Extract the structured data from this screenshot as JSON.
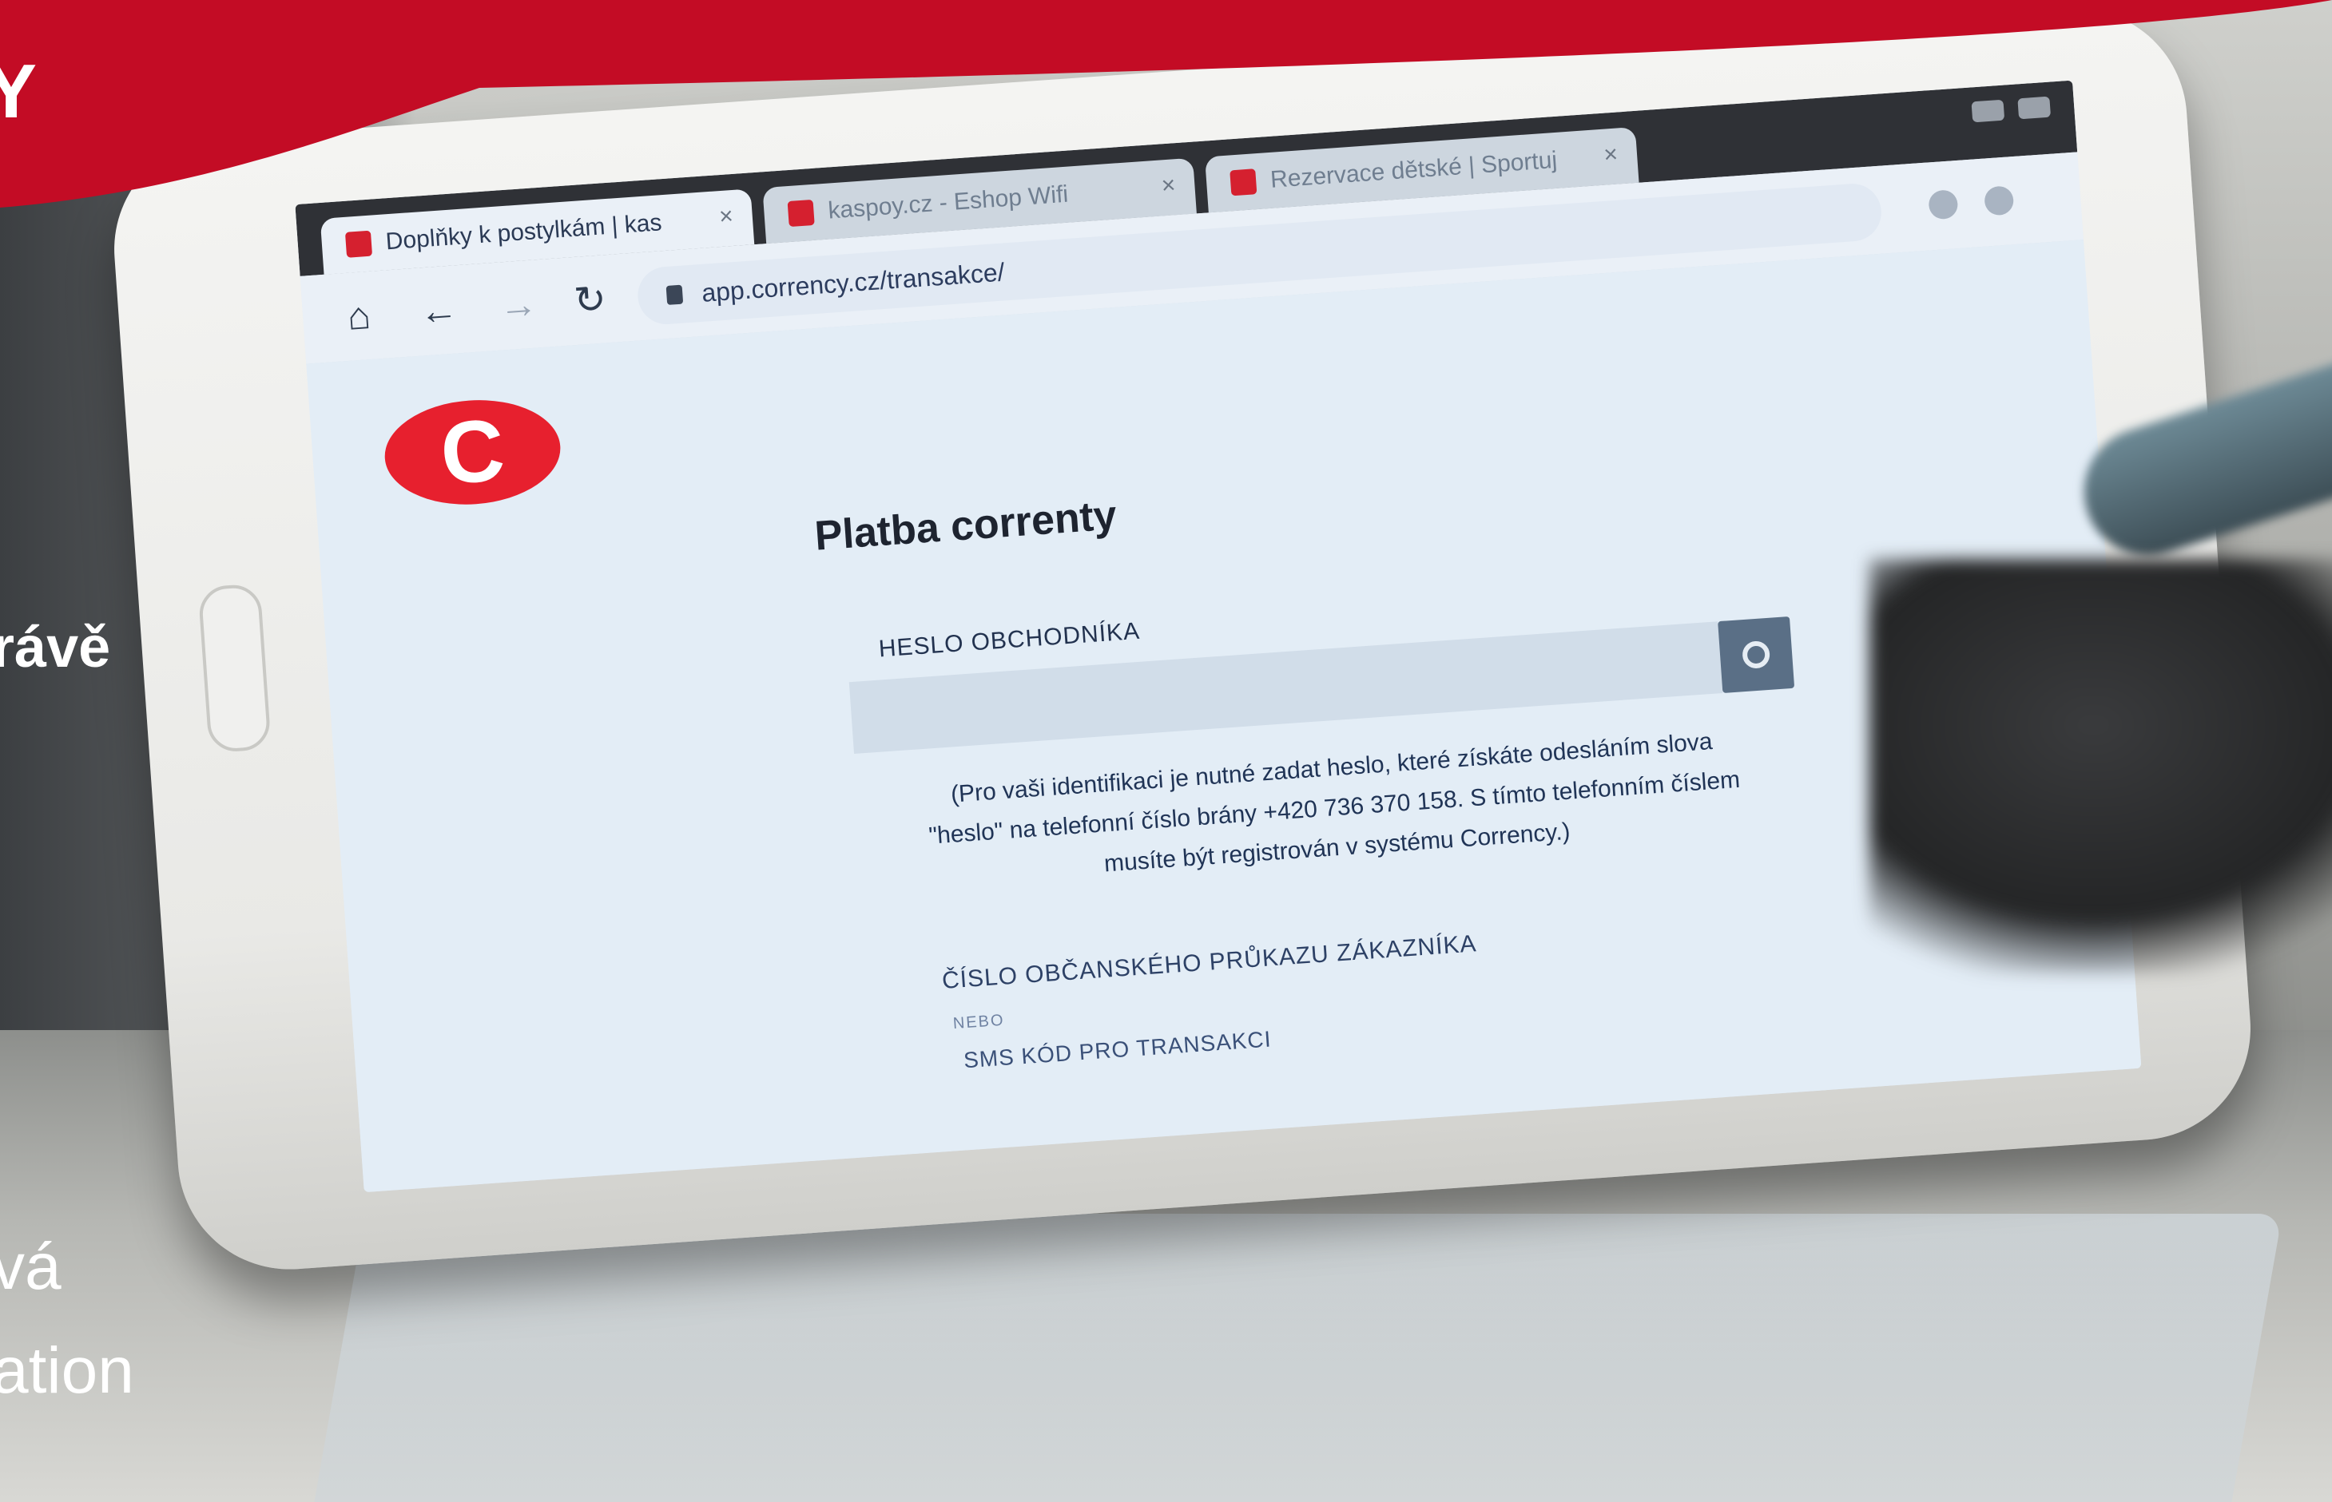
{
  "banner": {
    "color": "#c30c25",
    "logo_text": "Y"
  },
  "side_text": {
    "line1": "rávě",
    "line2": "vá",
    "line3": "ation"
  },
  "browser": {
    "tabs": [
      {
        "label": "Doplňky k postylkám | kas",
        "active": true
      },
      {
        "label": "kaspoy.cz - Eshop Wifi",
        "active": false
      },
      {
        "label": "Rezervace dětské | Sportuj",
        "active": false
      }
    ],
    "tab_close": "×",
    "url": "app.corrency.cz/transakce/"
  },
  "page": {
    "logo_letter": "C",
    "logo_color": "#e7202e",
    "title": "Platba correnty",
    "password_label": "HESLO OBCHODNÍKA",
    "help_text": "(Pro vaši identifikaci je nutné zadat heslo, které získáte odesláním slova \"heslo\" na telefonní číslo brány +420 736 370 158. S tímto telefonním číslem musíte být registrován v systému Corrency.)",
    "id_label": "ČÍSLO OBČANSKÉHO PRŮKAZU ZÁKAZNÍKA",
    "or_label": "NEBO",
    "sms_label": "SMS KÓD PRO TRANSAKCI"
  }
}
